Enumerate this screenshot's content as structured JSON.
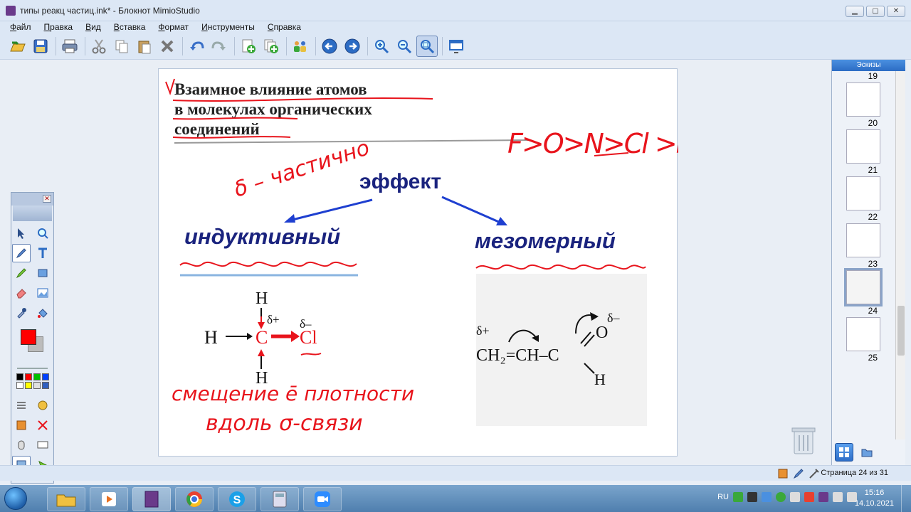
{
  "window": {
    "title": "типы реакц частиц.ink* - Блокнот MimioStudio",
    "buttons": [
      "minimize",
      "maximize",
      "close"
    ]
  },
  "menu": {
    "items": [
      "Файл",
      "Правка",
      "Вид",
      "Вставка",
      "Формат",
      "Инструменты",
      "Справка"
    ]
  },
  "toolbar": {
    "icons": [
      "open-icon",
      "save-icon",
      "print-icon",
      "cut-icon",
      "copy-icon",
      "paste-icon",
      "delete-icon",
      "undo-icon",
      "redo-icon",
      "new-page-icon",
      "duplicate-page-icon",
      "users-icon",
      "back-icon",
      "forward-icon",
      "zoom-in-icon",
      "zoom-out-icon",
      "zoom-fit-icon",
      "screen-icon"
    ]
  },
  "slide": {
    "heading_line1": "Взаимное влияние атомов",
    "heading_line2": "в молекулах органических",
    "heading_line3": "соединений",
    "effect_label": "эффект",
    "inductive_label": "индуктивный",
    "mesomeric_label": "мезомерный",
    "ink_electroneg": "F>O>N>Cl >H",
    "ink_sigma": "δ – частично",
    "ink_shift_1": "смещение ē плотности",
    "ink_shift_2": "вдоль σ-связи",
    "ind_H_top": "H",
    "ind_H_left": "H",
    "ind_H_bottom": "H",
    "ind_C": "C",
    "ind_Cl": "Cl",
    "ind_delta_plus": "δ+",
    "ind_delta_minus": "δ–",
    "meso_delta_plus": "δ+",
    "meso_delta_minus": "δ–",
    "meso_chain": "CH₂=CH–C",
    "meso_O": "O",
    "meso_H": "H"
  },
  "thumbnails": {
    "header": "Эскизы",
    "pages": [
      "19",
      "20",
      "21",
      "22",
      "23",
      "24",
      "25"
    ],
    "selected": "24"
  },
  "status": {
    "page_indicator": "Страница 24 из 31"
  },
  "taskbar": {
    "lang": "RU",
    "time": "15:16",
    "date": "14.10.2021"
  },
  "colors": {
    "ink_red": "#e8141c",
    "heading_blue": "#1a237e",
    "arrow_blue": "#1e3fd0",
    "current_color": "#ff0000"
  }
}
